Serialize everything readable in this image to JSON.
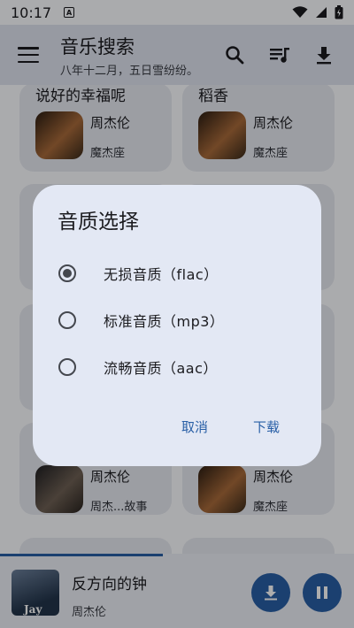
{
  "status_bar": {
    "time": "10:17",
    "badge": "A"
  },
  "app_bar": {
    "title": "音乐搜索",
    "subtitle": "八年十二月，五日雪纷纷。"
  },
  "cards": [
    {
      "name": "说好的幸福呢",
      "artist": "周杰伦",
      "album": "魔杰座"
    },
    {
      "name": "稻香",
      "artist": "周杰伦",
      "album": "魔杰座"
    },
    {
      "name": "",
      "artist": "周杰伦",
      "album": "周杰...故事"
    },
    {
      "name": "",
      "artist": "周杰伦",
      "album": "魔杰座"
    }
  ],
  "dialog": {
    "title": "音质选择",
    "options": [
      {
        "label": "无损音质（flac）",
        "checked": true
      },
      {
        "label": "标准音质（mp3）",
        "checked": false
      },
      {
        "label": "流畅音质（aac）",
        "checked": false
      }
    ],
    "cancel": "取消",
    "confirm": "下载"
  },
  "player": {
    "song": "反方向的钟",
    "artist": "周杰伦",
    "cover_text": "Jay",
    "progress": 0.46
  },
  "colors": {
    "accent": "#295fa6",
    "dialog_bg": "#e3e8f4",
    "appbar_bg": "#dfe3ef"
  },
  "icons": [
    "menu-icon",
    "search-icon",
    "playlist-icon",
    "download-icon",
    "wifi-icon",
    "signal-icon",
    "battery-icon",
    "pause-icon"
  ]
}
